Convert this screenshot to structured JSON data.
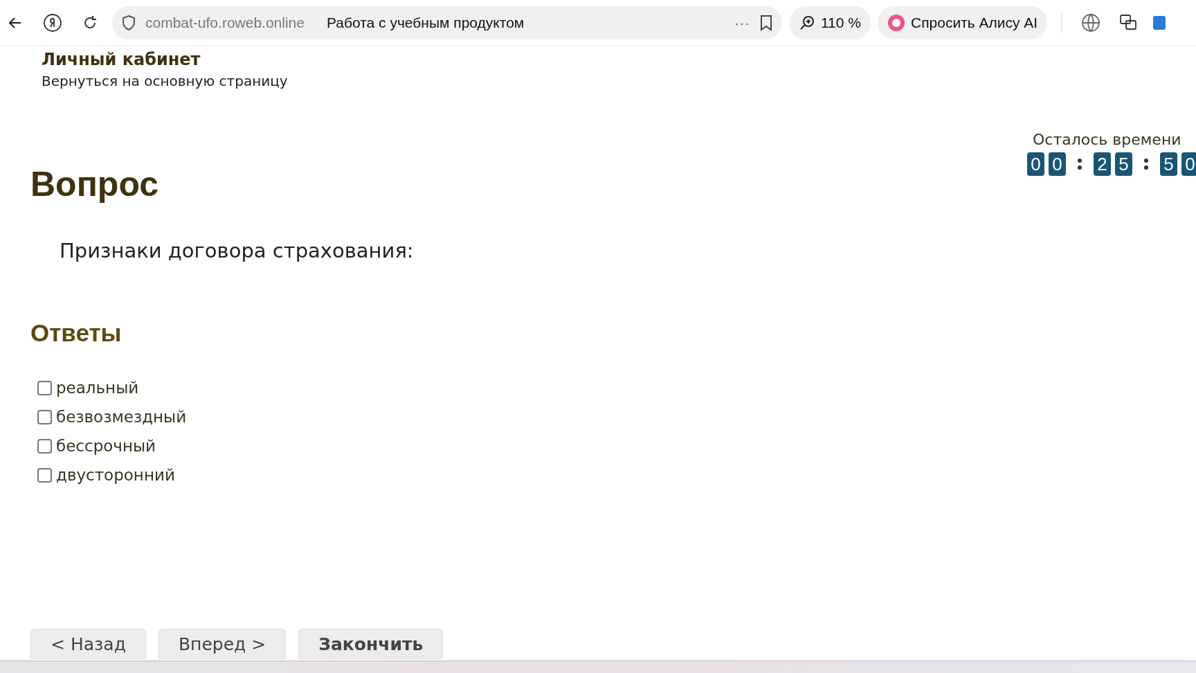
{
  "browser": {
    "url": "combat-ufo.roweb.online",
    "page_title": "Работа с учебным продуктом",
    "more": "···",
    "zoom": "110 %",
    "assistant": "Спросить Алису AI"
  },
  "header": {
    "title": "Личный кабинет",
    "back_link": "Вернуться на основную страницу"
  },
  "timer": {
    "label": "Осталось времени",
    "groups": [
      [
        "0",
        "0"
      ],
      [
        "2",
        "5"
      ],
      [
        "5",
        "0"
      ]
    ]
  },
  "question": {
    "heading": "Вопрос",
    "text": "Признаки договора страхования:"
  },
  "answers": {
    "heading": "Ответы",
    "options": [
      {
        "label": "реальный",
        "checked": false
      },
      {
        "label": "безвозмездный",
        "checked": false
      },
      {
        "label": "бессрочный",
        "checked": false
      },
      {
        "label": "двусторонний",
        "checked": false
      }
    ]
  },
  "buttons": [
    {
      "label": "< Назад",
      "kind": "nav"
    },
    {
      "label": "Вперед >",
      "kind": "nav"
    },
    {
      "label": "Закончить",
      "kind": "finish"
    }
  ]
}
